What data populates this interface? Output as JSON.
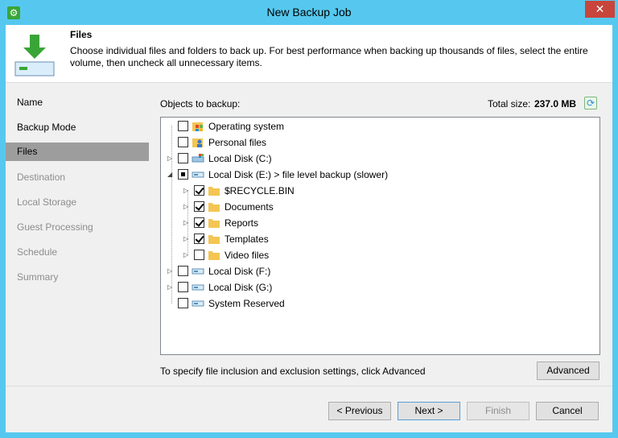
{
  "window": {
    "title": "New Backup Job",
    "close_glyph": "✕",
    "app_icon": "gear-icon"
  },
  "header": {
    "title": "Files",
    "description": "Choose individual files and folders to back up. For best performance when backing up thousands of files, select the entire volume, then uncheck all unnecessary items."
  },
  "sidebar": {
    "items": [
      {
        "label": "Name",
        "state": "enabled"
      },
      {
        "label": "Backup Mode",
        "state": "enabled"
      },
      {
        "label": "Files",
        "state": "active"
      },
      {
        "label": "Destination",
        "state": "disabled"
      },
      {
        "label": "Local Storage",
        "state": "disabled"
      },
      {
        "label": "Guest Processing",
        "state": "disabled"
      },
      {
        "label": "Schedule",
        "state": "disabled"
      },
      {
        "label": "Summary",
        "state": "disabled"
      }
    ]
  },
  "objects": {
    "label": "Objects to backup:",
    "total_size_label": "Total size:",
    "total_size_value": "237.0 MB",
    "tree": [
      {
        "label": "Operating system",
        "level": 0,
        "expander": "",
        "check": "unchecked",
        "icon": "os-icon"
      },
      {
        "label": "Personal files",
        "level": 0,
        "expander": "",
        "check": "unchecked",
        "icon": "user-folder-icon"
      },
      {
        "label": "Local Disk (C:)",
        "level": 0,
        "expander": "collapsed",
        "check": "unchecked",
        "icon": "system-disk-icon"
      },
      {
        "label": "Local Disk (E:) > file level backup (slower)",
        "level": 0,
        "expander": "expanded",
        "check": "partial",
        "icon": "disk-icon"
      },
      {
        "label": "$RECYCLE.BIN",
        "level": 1,
        "expander": "collapsed",
        "check": "checked",
        "icon": "folder-icon"
      },
      {
        "label": "Documents",
        "level": 1,
        "expander": "collapsed",
        "check": "checked",
        "icon": "folder-icon"
      },
      {
        "label": "Reports",
        "level": 1,
        "expander": "collapsed",
        "check": "checked",
        "icon": "folder-icon"
      },
      {
        "label": "Templates",
        "level": 1,
        "expander": "collapsed",
        "check": "checked",
        "icon": "folder-icon"
      },
      {
        "label": "Video files",
        "level": 1,
        "expander": "collapsed",
        "check": "unchecked",
        "icon": "folder-icon"
      },
      {
        "label": "Local Disk (F:)",
        "level": 0,
        "expander": "collapsed",
        "check": "unchecked",
        "icon": "disk-icon"
      },
      {
        "label": "Local Disk (G:)",
        "level": 0,
        "expander": "collapsed",
        "check": "unchecked",
        "icon": "disk-icon"
      },
      {
        "label": "System Reserved",
        "level": 0,
        "expander": "",
        "check": "unchecked",
        "icon": "disk-icon"
      }
    ]
  },
  "hint": "To specify file inclusion and exclusion settings, click Advanced",
  "buttons": {
    "advanced": "Advanced",
    "previous": "< Previous",
    "next": "Next >",
    "finish": "Finish",
    "cancel": "Cancel"
  },
  "colors": {
    "titlebar": "#56c8ef",
    "close": "#c7453b",
    "active_nav": "#9d9d9d",
    "folder": "#f4c553",
    "disk": "#9ec7e3"
  }
}
